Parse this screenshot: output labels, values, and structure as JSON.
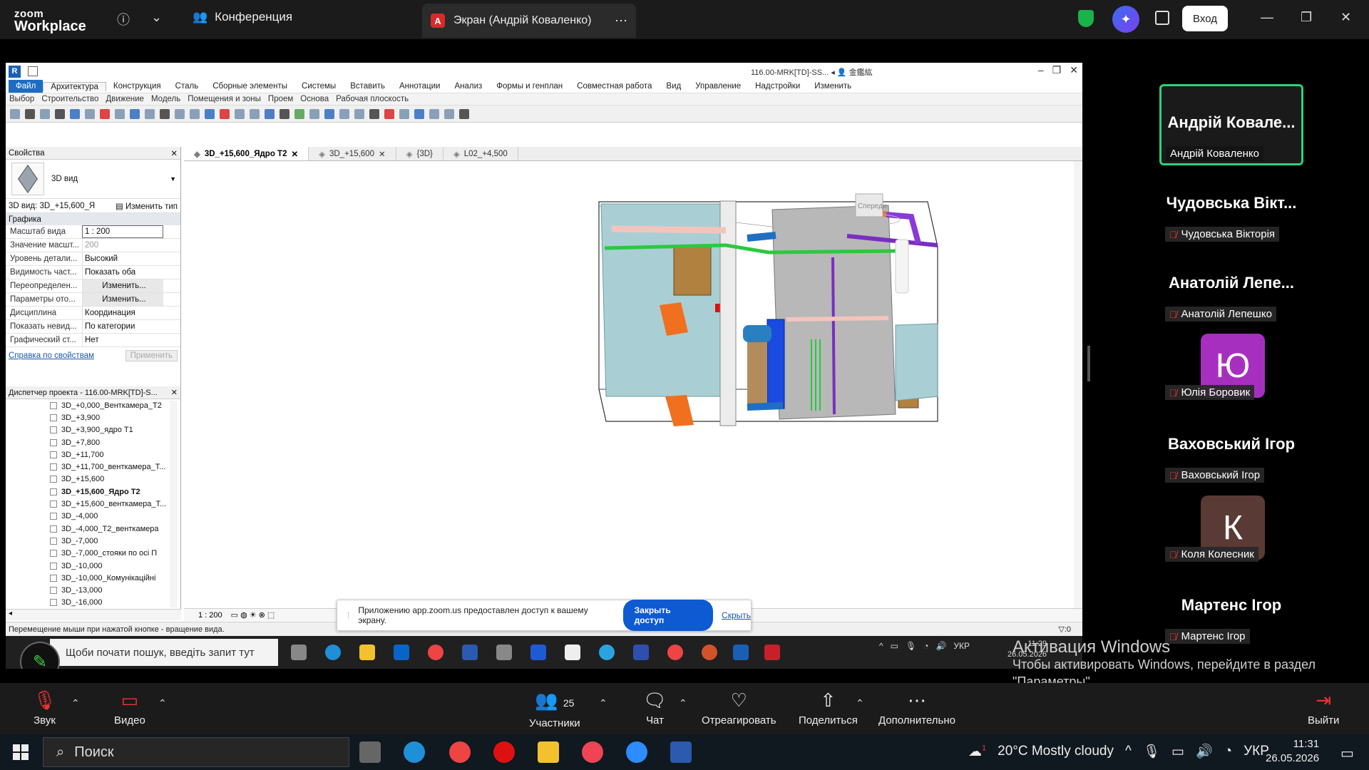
{
  "zoom": {
    "brand_line1": "zoom",
    "brand_line2": "Workplace",
    "meeting_title": "Конференция",
    "screen_tab": "Экран (Андрій Коваленко)",
    "login_label": "Вход"
  },
  "revit": {
    "title": "116.00-MRK[TD]-SS...",
    "user": "金鑑紘",
    "menus": [
      "Файл",
      "Архитектура",
      "Конструкция",
      "Сталь",
      "Сборные элементы",
      "Системы",
      "Вставить",
      "Аннотации",
      "Анализ",
      "Формы и генплан",
      "Совместная работа",
      "Вид",
      "Управление",
      "Надстройки",
      "Изменить"
    ],
    "submenus": [
      "Выбор",
      "Строительство",
      "Движение",
      "Модель",
      "Помещения и зоны",
      "Проем",
      "Основа",
      "Рабочая плоскость"
    ],
    "properties": {
      "header": "Свойства",
      "type_name": "3D вид",
      "selector": "3D вид: 3D_+15,600_Я",
      "edit_type": "Изменить тип",
      "group": "Графика",
      "rows": [
        {
          "k": "Масштаб вида",
          "v": "1 : 200"
        },
        {
          "k": "Значение масшт...",
          "v": "200"
        },
        {
          "k": "Уровень детали...",
          "v": "Высокий"
        },
        {
          "k": "Видимость част...",
          "v": "Показать оба"
        },
        {
          "k": "Переопределен...",
          "v": "Изменить..."
        },
        {
          "k": "Параметры ото...",
          "v": "Изменить..."
        },
        {
          "k": "Дисциплина",
          "v": "Координация"
        },
        {
          "k": "Показать невид...",
          "v": "По категории"
        },
        {
          "k": "Графический ст...",
          "v": "Нет"
        }
      ],
      "help_link": "Справка по свойствам",
      "apply": "Применить"
    },
    "browser": {
      "header": "Диспетчер проекта - 116.00-MRK[TD]-S...",
      "items": [
        "3D_+0,000_Венткамера_Т2",
        "3D_+3,900",
        "3D_+3,900_ядро Т1",
        "3D_+7,800",
        "3D_+11,700",
        "3D_+11,700_венткамера_Т...",
        "3D_+15,600",
        "3D_+15,600_Ядро Т2",
        "3D_+15,600_венткамера_Т...",
        "3D_-4,000",
        "3D_-4,000_Т2_венткамера",
        "3D_-7,000",
        "3D_-7,000_стояки по осі П",
        "3D_-10,000",
        "3D_-10,000_Комунікаційні",
        "3D_-13,000",
        "3D_-16,000"
      ],
      "active_index": 7
    },
    "view_tabs": [
      "3D_+15,600_Ядро Т2",
      "3D_+15,600",
      "{3D}",
      "L02_+4,500"
    ],
    "viewcube_label": "Спереди",
    "view_scale": "1 : 200",
    "status": "Перемещение мыши при нажатой кнопке - вращение вида.",
    "filter_count": ":0"
  },
  "remote_taskbar": {
    "search": "Щоби почати пошук, введіть запит тут",
    "lang": "УКР",
    "time": "11:29",
    "date": "26.05.2026"
  },
  "share_notice": {
    "text": "Приложению app.zoom.us предоставлен доступ к вашему экрану.",
    "close_label": "Закрыть доступ",
    "hide_label": "Скрыть"
  },
  "participants": [
    {
      "name": "Андрій Ковале...",
      "label": "Андрій Коваленко",
      "muted": false
    },
    {
      "name": "Чудовська Вікт...",
      "label": "Чудовська Вікторія",
      "muted": true
    },
    {
      "name": "Анатолій Лепе...",
      "label": "Анатолій Лепешко",
      "muted": true
    },
    {
      "name": "",
      "label": "Юлія Боровик",
      "muted": true,
      "avatar": "Ю",
      "avatar_color": "#a72fbf"
    },
    {
      "name": "Ваховський Ігор",
      "label": "Ваховський Ігор",
      "muted": true
    },
    {
      "name": "",
      "label": "Коля Колесник",
      "muted": true,
      "avatar": "К",
      "avatar_color": "#5a3a34"
    },
    {
      "name": "Мартенс Ігор",
      "label": "Мартенс Ігор",
      "muted": true
    }
  ],
  "activation": {
    "title": "Активация Windows",
    "line1": "Чтобы активировать Windows, перейдите в раздел",
    "line2": "\"Параметры\"."
  },
  "zoom_bottom": {
    "audio": "Звук",
    "video": "Видео",
    "participants": "Участники",
    "participants_count": "25",
    "chat": "Чат",
    "react": "Отреагировать",
    "share": "Поделиться",
    "more": "Дополнительно",
    "leave": "Выйти"
  },
  "windows_taskbar": {
    "search": "Поиск",
    "weather": "20°C  Mostly cloudy",
    "weather_badge": "1",
    "lang": "УКР",
    "time": "11:31",
    "date": "26.05.2026"
  }
}
